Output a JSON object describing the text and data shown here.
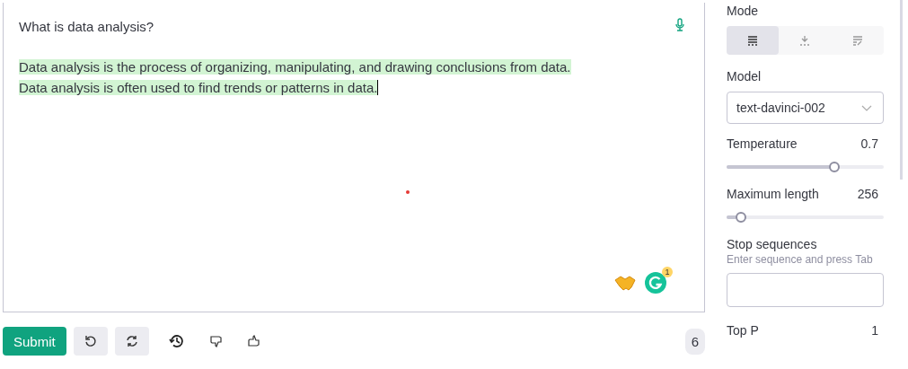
{
  "editor": {
    "prompt": "What is data analysis?",
    "completion": [
      "Data analysis is the process of organizing, manipulating, and drawing conclusions from data.",
      "Data analysis is often used to find trends or patterns in data."
    ],
    "grammarly_badge": "1"
  },
  "actions": {
    "submit": "Submit",
    "token_count": "6"
  },
  "settings": {
    "mode_label": "Mode",
    "modes": [
      {
        "kind": "complete",
        "selected": true
      },
      {
        "kind": "insert",
        "selected": false
      },
      {
        "kind": "edit",
        "selected": false
      }
    ],
    "model_label": "Model",
    "model": "text-davinci-002",
    "sliders": [
      {
        "label": "Temperature",
        "reading": "0.7",
        "level": 0.7
      },
      {
        "label": "Maximum length",
        "reading": "256",
        "level": 0.06
      }
    ],
    "stop_label": "Stop sequences",
    "stop_hint": "Enter sequence and press Tab",
    "top_p": {
      "label": "Top P",
      "reading": "1"
    }
  }
}
